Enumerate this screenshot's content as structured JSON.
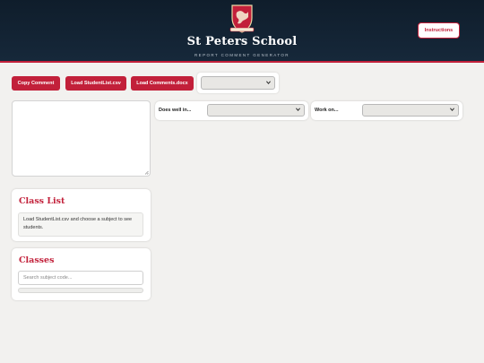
{
  "header": {
    "school_name": "St Peters School",
    "subtitle": "REPORT COMMENT GENERATOR",
    "crest_icon": "school-crest-icon",
    "instructions_label": "Instructions"
  },
  "toolbar": {
    "copy_label": "Copy Comment",
    "load_students_label": "Load StudentList.csv",
    "load_comments_label": "Load Comments.docx",
    "select_value": ""
  },
  "comment_box": {
    "value": ""
  },
  "does_well": {
    "label": "Does well in...",
    "value": ""
  },
  "work_on": {
    "label": "Work on...",
    "value": ""
  },
  "class_list": {
    "title": "Class List",
    "message": "Load StudentList.csv and choose a subject to see students."
  },
  "classes": {
    "title": "Classes",
    "search_placeholder": "Search subject code..."
  },
  "colors": {
    "accent": "#c2203a",
    "header_bg": "#13233a",
    "page_bg": "#f2f1ef"
  }
}
